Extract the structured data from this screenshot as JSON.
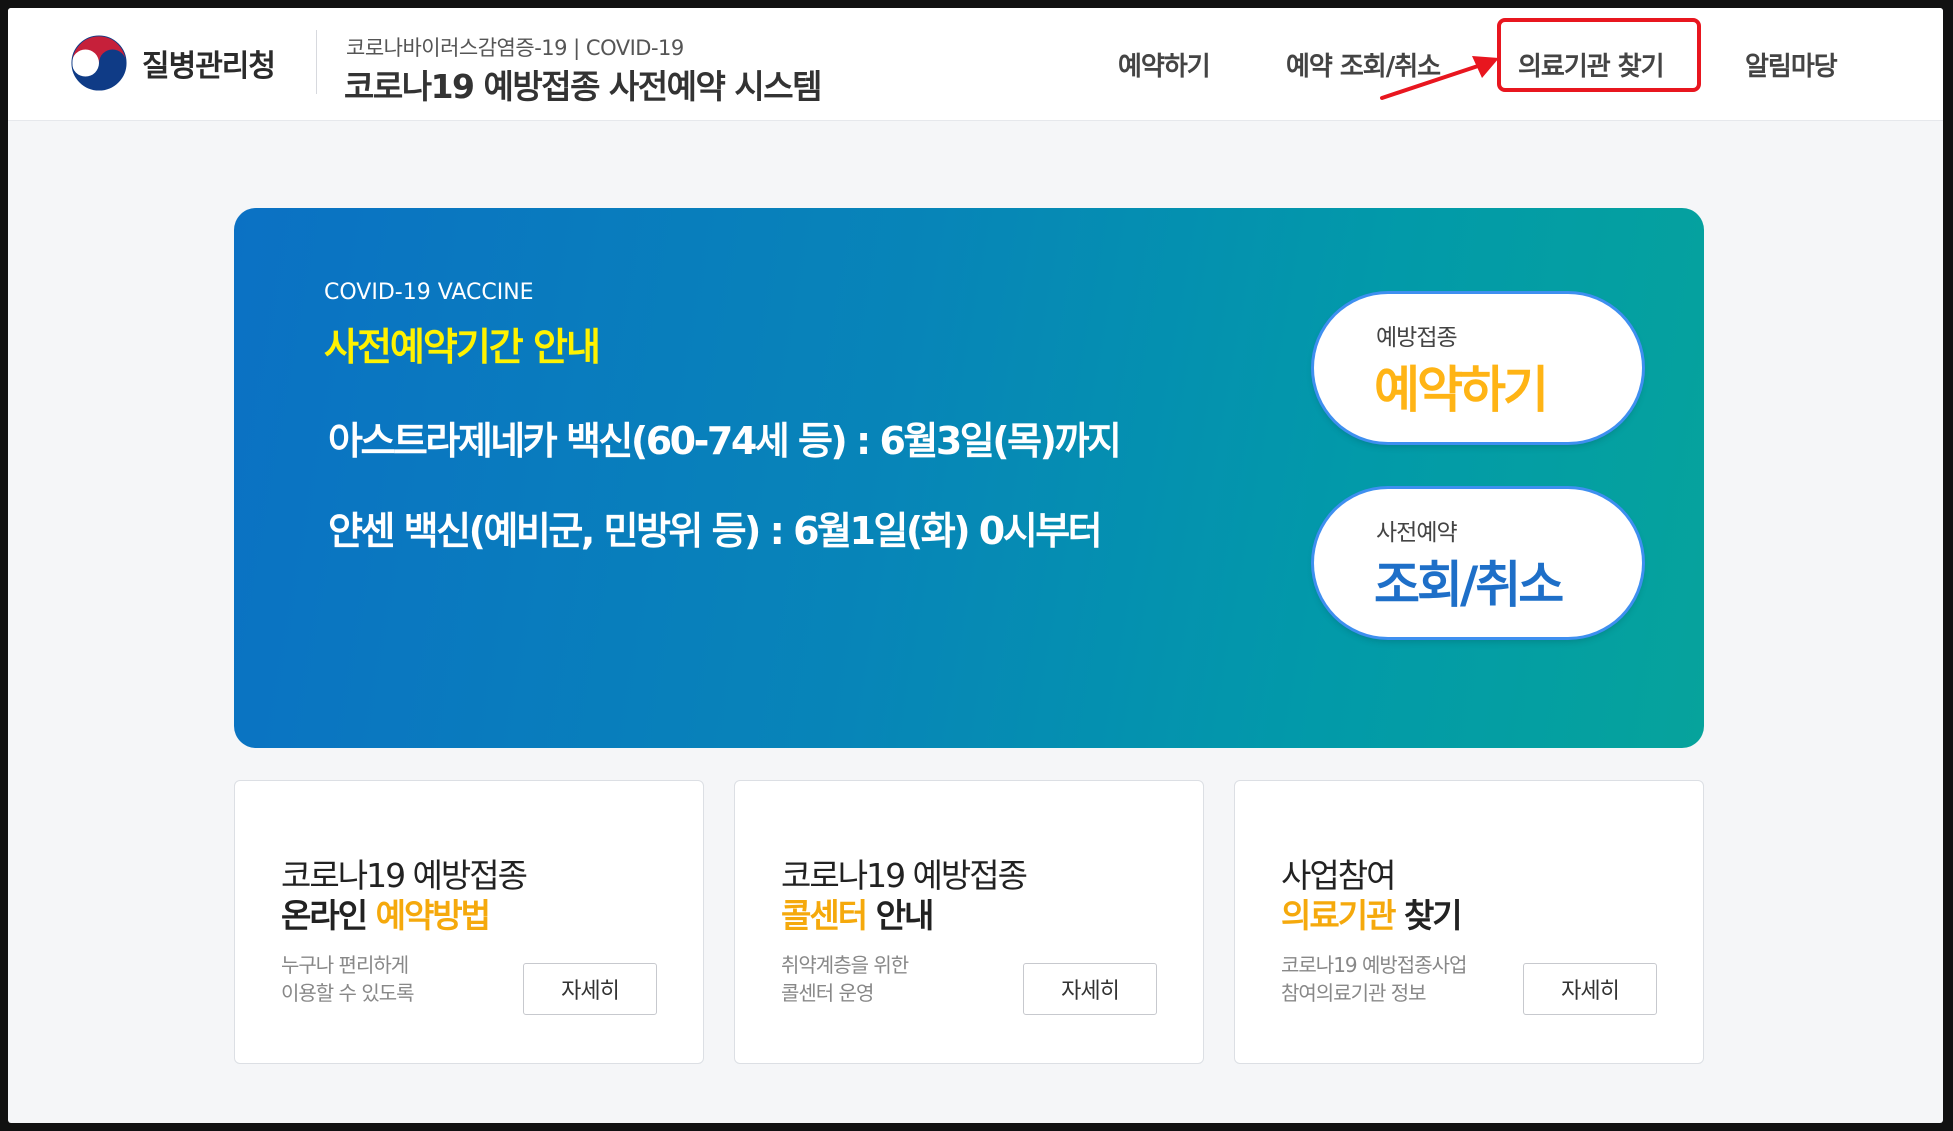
{
  "header": {
    "agency_name": "질병관리청",
    "site_subtitle": "코로나바이러스감염증-19 | COVID-19",
    "site_title": "코로나19 예방접종 사전예약 시스템",
    "nav": [
      {
        "label": "예약하기"
      },
      {
        "label": "예약 조회/취소"
      },
      {
        "label": "의료기관 찾기",
        "highlighted": true
      },
      {
        "label": "알림마당"
      }
    ],
    "highlight_color": "#e8161f"
  },
  "banner": {
    "eyebrow": "COVID-19 VACCINE",
    "title": "사전예약기간 안내",
    "line1": "아스트라제네카 백신(60-74세 등) : 6월3일(목)까지",
    "line2": "얀센 백신(예비군, 민방위 등) : 6월1일(화) 0시부터",
    "btn_reserve": {
      "small": "예방접종",
      "big": "예약하기"
    },
    "btn_lookup": {
      "small": "사전예약",
      "big": "조회/취소"
    },
    "colors": {
      "title": "#fff200",
      "reserve_big": "#ffb415",
      "lookup_big": "#1e6fc8"
    }
  },
  "cards": [
    {
      "line1": "코로나19 예방접종",
      "line2_highlight": "온라인 ",
      "line2_accent": "예약방법",
      "desc1": "누구나 편리하게",
      "desc2": "이용할 수 있도록",
      "button": "자세히"
    },
    {
      "line1": "코로나19 예방접종",
      "line2_accent": "콜센터",
      "line2_rest": " 안내",
      "desc1": "취약계층을 위한",
      "desc2": "콜센터 운영",
      "button": "자세히"
    },
    {
      "line1": "사업참여",
      "line2_accent": "의료기관",
      "line2_rest": " 찾기",
      "desc1": "코로나19 예방접종사업",
      "desc2": "참여의료기관 정보",
      "button": "자세히"
    }
  ],
  "accent_color": "#f5a90c"
}
